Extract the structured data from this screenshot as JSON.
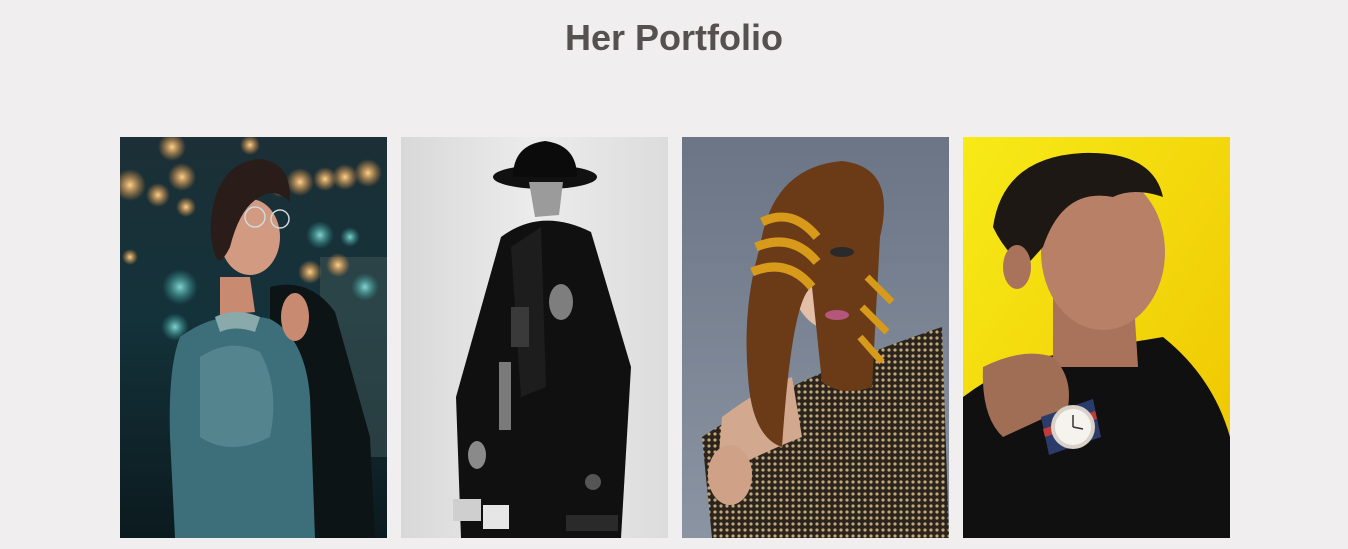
{
  "header": {
    "title": "Her Portfolio"
  },
  "portfolio": {
    "images": [
      {
        "subject": "woman-lace-dress-night-bokeh-photo"
      },
      {
        "subject": "man-black-coat-hat-bw-photo"
      },
      {
        "subject": "woman-striped-hair-sequin-top-photo"
      },
      {
        "subject": "man-turtleneck-wristwatch-yellow-photo"
      }
    ]
  }
}
